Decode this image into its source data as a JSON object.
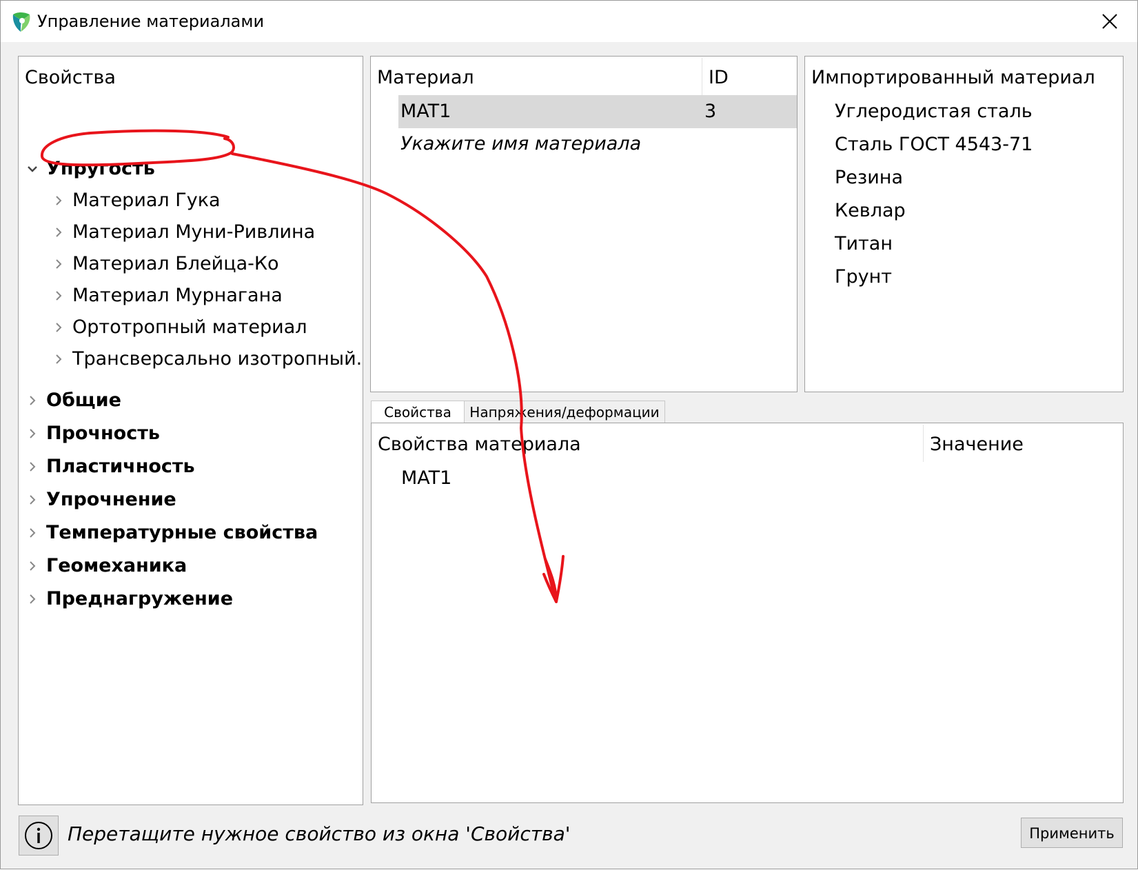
{
  "window": {
    "title": "Управление материалами"
  },
  "tree": {
    "header": "Свойства",
    "categories": [
      {
        "label": "Упругость",
        "expanded": true,
        "children": [
          "Материал Гука",
          "Материал Муни-Ривлина",
          "Материал Блейца-Ко",
          "Материал Мурнагана",
          "Ортотропный материал",
          "Трансверсально изотропный..."
        ]
      },
      {
        "label": "Общие"
      },
      {
        "label": "Прочность"
      },
      {
        "label": "Пластичность"
      },
      {
        "label": "Упрочнение"
      },
      {
        "label": "Температурные свойства"
      },
      {
        "label": "Геомеханика"
      },
      {
        "label": "Преднагружение"
      }
    ]
  },
  "materials": {
    "col_material": "Материал",
    "col_id": "ID",
    "rows": [
      {
        "name": "MAT1",
        "id": "3"
      }
    ],
    "new_row_hint": "Укажите имя материала"
  },
  "imported": {
    "header": "Импортированный материал",
    "items": [
      "Углеродистая сталь",
      "Сталь ГОСТ 4543-71",
      "Резина",
      "Кевлар",
      "Титан",
      "Грунт"
    ]
  },
  "tabs": [
    "Свойства",
    "Напряжения/деформации"
  ],
  "properties": {
    "col_property": "Свойства материала",
    "col_value": "Значение",
    "rows": [
      "MAT1"
    ]
  },
  "status": {
    "text": "Перетащите нужное свойство из окна 'Свойства'"
  },
  "apply_button": "Применить",
  "colors": {
    "annotation": "#e8141b",
    "selection": "#d9d9d9",
    "logo_green": "#3db54a",
    "logo_teal": "#1a8fa0"
  },
  "annotation": "hand-drawn red circle around 'Материал Гука' with an arrow pointing into the properties table"
}
